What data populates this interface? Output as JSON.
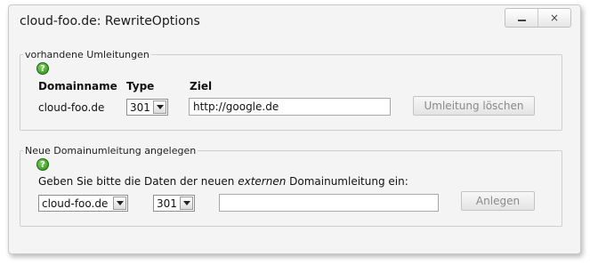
{
  "window": {
    "title": "cloud-foo.de: RewriteOptions",
    "minimize_icon": "minimize-icon",
    "close_label": "×"
  },
  "existing": {
    "legend": "vorhandene Umleitungen",
    "help_glyph": "?",
    "headers": {
      "domain": "Domainname",
      "type": "Type",
      "target": "Ziel"
    },
    "row": {
      "domain": "cloud-foo.de",
      "type_selected": "301",
      "target_value": "http://google.de",
      "delete_label": "Umleitung löschen"
    }
  },
  "new": {
    "legend": "Neue Domainumleitung angelegen",
    "help_glyph": "?",
    "instruction_pre": "Geben Sie bitte die Daten der neuen ",
    "instruction_em": "externen",
    "instruction_post": " Domainumleitung ein:",
    "domain_selected": "cloud-foo.de",
    "type_selected": "301",
    "target_value": "",
    "create_label": "Anlegen"
  }
}
